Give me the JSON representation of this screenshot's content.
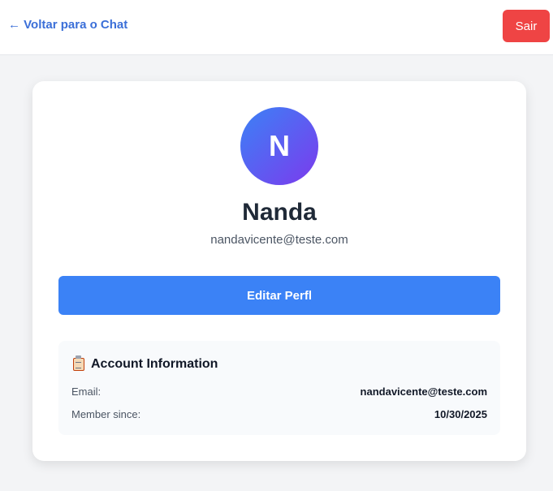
{
  "header": {
    "back_label": "← Voltar para o Chat",
    "logout_label": "Sair"
  },
  "profile": {
    "avatar_initial": "N",
    "name": "Nanda",
    "email": "nandavicente@teste.com",
    "edit_label": "Editar Perfl"
  },
  "account_info": {
    "title": "Account Information",
    "icon": "clipboard-icon",
    "rows": [
      {
        "label": "Email:",
        "value": "nandavicente@teste.com"
      },
      {
        "label": "Member since:",
        "value": "10/30/2025"
      }
    ]
  },
  "colors": {
    "accent": "#3b82f6",
    "danger": "#ef4444",
    "link": "#3b6fd8",
    "avatar_gradient_start": "#3b82f6",
    "avatar_gradient_end": "#7c3aed"
  }
}
